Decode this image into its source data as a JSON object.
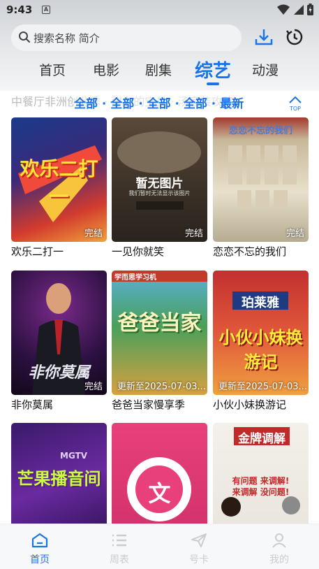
{
  "status_bar": {
    "time": "9:43",
    "notification_badge": "A"
  },
  "search": {
    "placeholder": "搜索名称 简介"
  },
  "tabs": [
    {
      "label": "首页",
      "active": false
    },
    {
      "label": "电影",
      "active": false
    },
    {
      "label": "剧集",
      "active": false
    },
    {
      "label": "综艺",
      "active": true
    },
    {
      "label": "动漫",
      "active": false
    }
  ],
  "ticker": {
    "text": "中餐厅非洲创业季  ·  甜心的宝贝  ·  汤家装攻略"
  },
  "filter": {
    "text": "全部 · 全部 · 全部 · 全部 · 最新"
  },
  "top_button": {
    "label": "TOP"
  },
  "items": [
    {
      "title": "欢乐二打一",
      "status": "完结",
      "poster_text": "欢乐二打一"
    },
    {
      "title": "一见你就笑",
      "status": "完结",
      "poster_text": "暂无图片"
    },
    {
      "title": "恋恋不忘的我们",
      "status": "完结",
      "poster_text": "恋恋不忘的我们"
    },
    {
      "title": "非你莫属",
      "status": "完结",
      "poster_text": "非你莫属"
    },
    {
      "title": "爸爸当家慢享季",
      "status": "更新至2025-07-03...",
      "poster_text": "爸爸当家"
    },
    {
      "title": "小伙小妹换游记",
      "status": "更新至2025-07-03...",
      "poster_text": "小伙小妹换游记"
    },
    {
      "title": "",
      "status": "",
      "poster_text": "芒果播音间"
    },
    {
      "title": "",
      "status": "",
      "poster_text": "文"
    },
    {
      "title": "",
      "status": "",
      "poster_text": "金牌调解"
    }
  ],
  "poster_extra": {
    "unavailable_sub": "我们暂时无法显示该图片",
    "brand_1": "学而思学习机",
    "brand_2": "珀莱雅",
    "brand_3": "MGTV",
    "mediation_1": "有问题 来调解!",
    "mediation_2": "来调解 没问题!"
  },
  "nav": [
    {
      "label": "首页",
      "icon": "home-icon",
      "active": true
    },
    {
      "label": "周表",
      "icon": "list-icon",
      "active": false
    },
    {
      "label": "号卡",
      "icon": "send-icon",
      "active": false
    },
    {
      "label": "我的",
      "icon": "user-icon",
      "active": false
    }
  ],
  "colors": {
    "accent": "#1a73e8",
    "inactive": "#c9ccd0"
  }
}
